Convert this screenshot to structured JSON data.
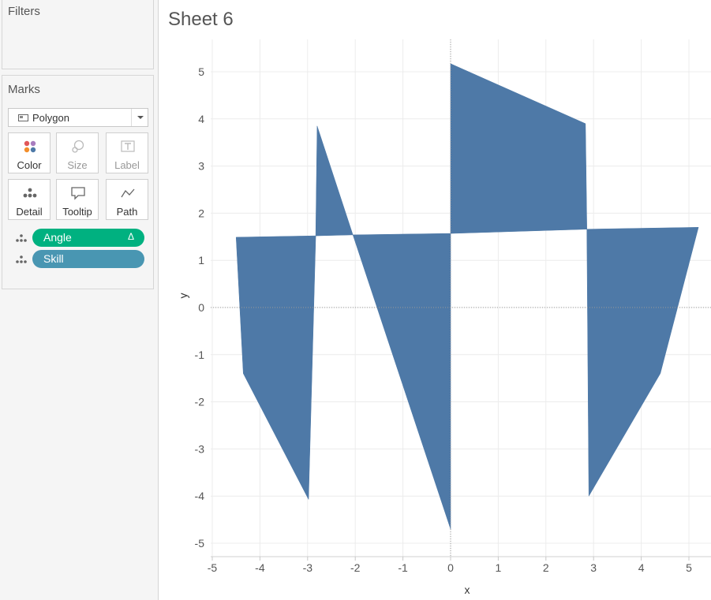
{
  "filters": {
    "title": "Filters"
  },
  "marks": {
    "title": "Marks",
    "mark_type": "Polygon",
    "buttons": {
      "color": "Color",
      "size": "Size",
      "label": "Label",
      "detail": "Detail",
      "tooltip": "Tooltip",
      "path": "Path"
    },
    "pills": [
      {
        "label": "Angle",
        "delta": "Δ",
        "color": "#00b180"
      },
      {
        "label": "Skill",
        "color": "#4996b2"
      }
    ]
  },
  "sheet": {
    "title": "Sheet 6"
  },
  "colors": {
    "polygon": "#4e79a7",
    "pill_green": "#00b180",
    "pill_blue": "#4996b2"
  },
  "chart_data": {
    "type": "area",
    "xlabel": "x",
    "ylabel": "y",
    "xlim": [
      -5.5,
      5.5
    ],
    "ylim": [
      -5.5,
      5.6
    ],
    "xticks": [
      -5,
      -4,
      -3,
      -2,
      -1,
      0,
      1,
      2,
      3,
      4,
      5
    ],
    "yticks": [
      -5,
      -4,
      -3,
      -2,
      -1,
      0,
      1,
      2,
      3,
      4,
      5
    ],
    "grid": true,
    "zero_lines": true,
    "polygons": [
      {
        "points": [
          [
            0,
            1.57
          ],
          [
            0,
            5.17
          ],
          [
            2.83,
            3.9
          ],
          [
            2.86,
            1.66
          ]
        ]
      },
      {
        "points": [
          [
            2.86,
            1.66
          ],
          [
            5.2,
            1.7
          ],
          [
            4.4,
            -1.4
          ],
          [
            2.9,
            -4.0
          ]
        ]
      },
      {
        "points": [
          [
            -2.83,
            1.52
          ],
          [
            -2.8,
            3.85
          ],
          [
            -2.05,
            1.54
          ]
        ]
      },
      {
        "points": [
          [
            -2.05,
            1.54
          ],
          [
            0,
            1.57
          ],
          [
            0,
            -4.7
          ]
        ]
      },
      {
        "points": [
          [
            -4.5,
            1.49
          ],
          [
            -2.83,
            1.52
          ],
          [
            -2.98,
            -4.07
          ],
          [
            -4.35,
            -1.4
          ]
        ]
      }
    ]
  }
}
